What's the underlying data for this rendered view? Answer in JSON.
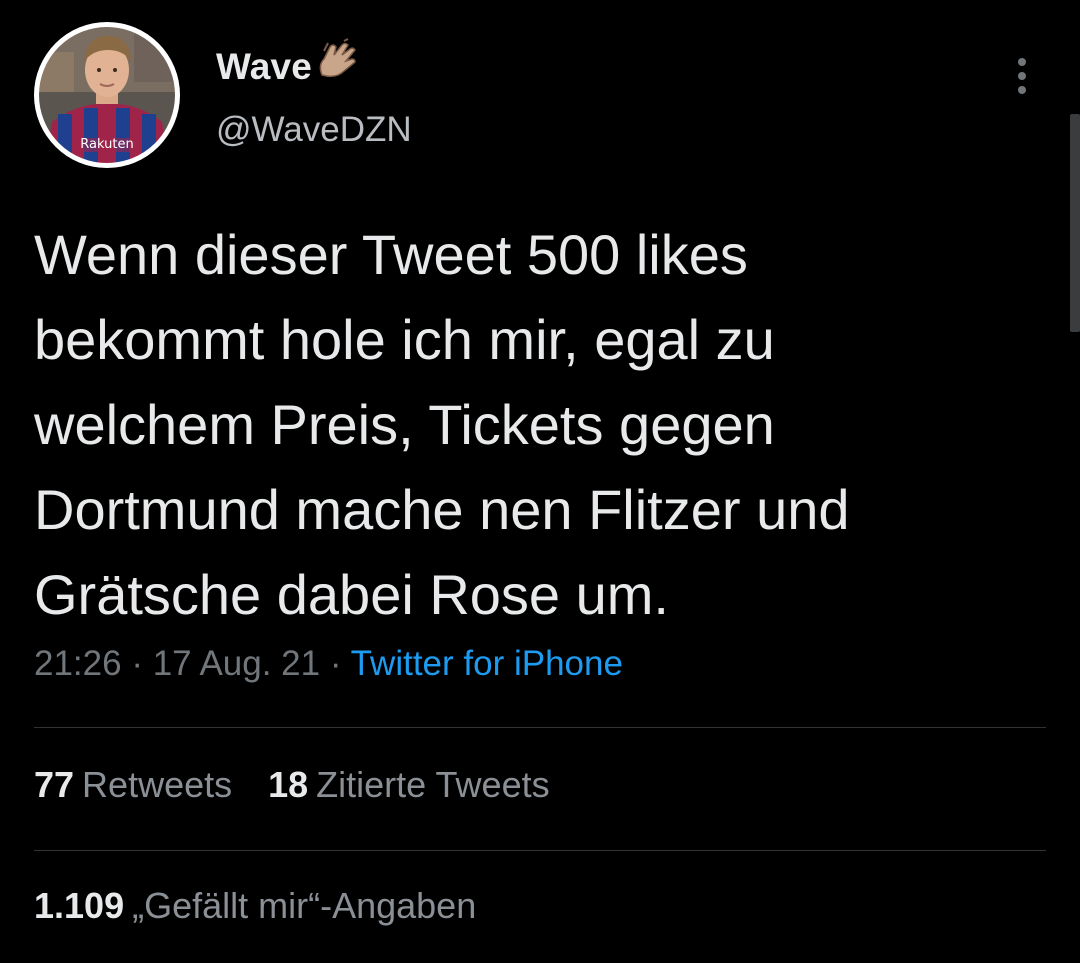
{
  "author": {
    "display_name": "Wave",
    "name_emoji": "hand-emoji",
    "handle": "@WaveDZN",
    "avatar_jersey_text": "Rakuten"
  },
  "tweet": {
    "text_lines": [
      "Wenn dieser Tweet 500 likes",
      "bekommt hole ich mir, egal zu",
      "welchem Preis, Tickets gegen",
      "Dortmund mache nen Flitzer und",
      "Grätsche dabei Rose um."
    ],
    "time": "21:26",
    "date": "17 Aug. 21",
    "separator": "·",
    "source": "Twitter for iPhone"
  },
  "stats": {
    "retweets_count": "77",
    "retweets_label": "Retweets",
    "quotes_count": "18",
    "quotes_label": "Zitierte Tweets",
    "likes_count": "1.109",
    "likes_label": "„Gefällt mir“-Angaben"
  },
  "icons": {
    "more": "more-vertical-icon"
  },
  "colors": {
    "background": "#000000",
    "text": "#e7e9ea",
    "secondary": "#71767b",
    "link": "#1d9bf0",
    "divider": "#2f3336"
  }
}
